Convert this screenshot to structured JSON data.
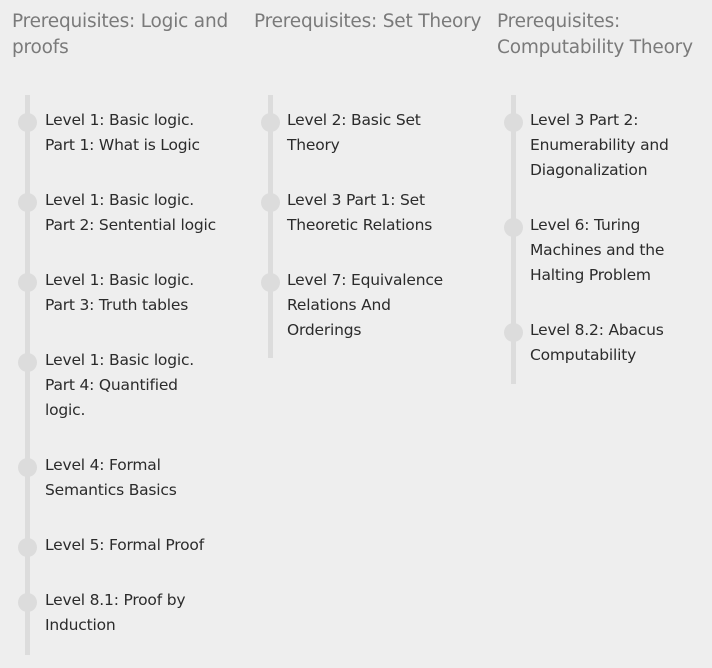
{
  "columns": [
    {
      "title": "Prerequisites: Logic and proofs",
      "items": [
        {
          "label": "Level 1: Basic logic. Part 1: What is Logic"
        },
        {
          "label": "Level 1: Basic logic. Part 2: Sentential logic"
        },
        {
          "label": "Level 1: Basic logic. Part 3: Truth tables"
        },
        {
          "label": "Level 1: Basic logic. Part 4: Quantified logic."
        },
        {
          "label": "Level 4: Formal Semantics Basics"
        },
        {
          "label": "Level 5: Formal Proof"
        },
        {
          "label": "Level 8.1: Proof by Induction"
        }
      ]
    },
    {
      "title": "Prerequisites: Set Theory",
      "items": [
        {
          "label": "Level 2: Basic Set Theory"
        },
        {
          "label": "Level 3 Part 1: Set Theoretic Relations"
        },
        {
          "label": "Level 7: Equivalence Relations And Orderings"
        }
      ]
    },
    {
      "title": "Prerequisites: Computability Theory",
      "items": [
        {
          "label": "Level 3 Part 2: Enumerability and Diagonalization"
        },
        {
          "label": "Level 6: Turing Machines and the Halting Problem"
        },
        {
          "label": "Level 8.2: Abacus Computability"
        }
      ]
    }
  ],
  "colors": {
    "background": "#eeeeee",
    "title_text": "#7a7a7a",
    "item_text": "#2b2b2b",
    "timeline": "#dcdcdc"
  }
}
